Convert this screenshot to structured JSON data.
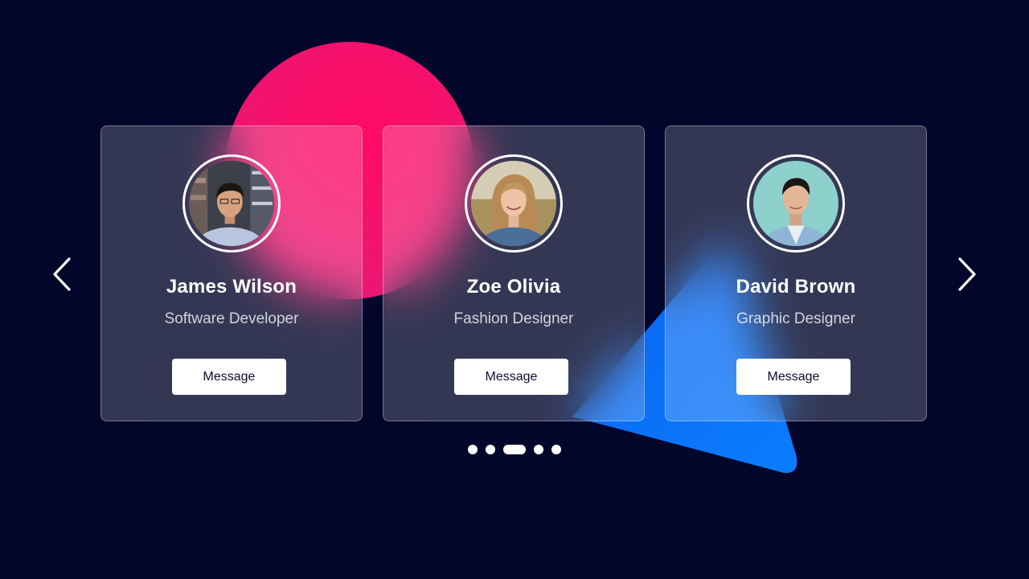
{
  "colors": {
    "background": "#02062a",
    "circle_accent": "#ff0a63",
    "triangle_accent": "#0a74ff",
    "card_surface": "rgba(255,255,255,0.2)",
    "button_bg": "#ffffff",
    "button_text": "#0b0f2c"
  },
  "carousel": {
    "prev_icon": "chevron-left-icon",
    "next_icon": "chevron-right-icon",
    "cards": [
      {
        "name": "James Wilson",
        "role": "Software Developer",
        "button_label": "Message",
        "avatar_icon": "person-photo"
      },
      {
        "name": "Zoe Olivia",
        "role": "Fashion Designer",
        "button_label": "Message",
        "avatar_icon": "person-photo"
      },
      {
        "name": "David Brown",
        "role": "Graphic Designer",
        "button_label": "Message",
        "avatar_icon": "person-photo"
      }
    ],
    "pagination": {
      "total": 5,
      "active_index": 2
    }
  }
}
